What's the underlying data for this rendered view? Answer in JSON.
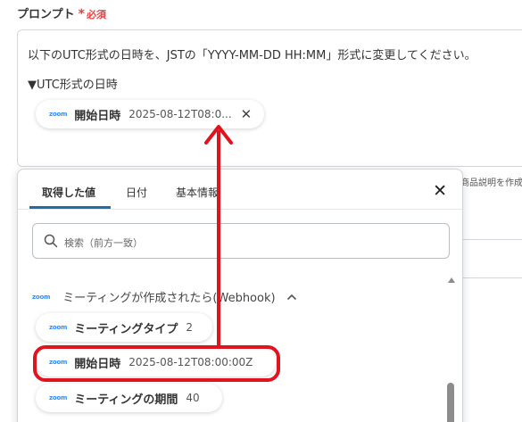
{
  "field": {
    "label": "プロンプト",
    "required_mark": "*",
    "required_text": "必須",
    "line1": "以下のUTC形式の日時を、JSTの「YYYY-MM-DD HH:MM」形式に変更してください。",
    "line2": "▼UTC形式の日時",
    "chip": {
      "logo": "zoom",
      "name": "開始日時",
      "value": "2025-08-12T08:0..."
    }
  },
  "background_hint": "商品説明を作成",
  "panel": {
    "tabs": [
      "取得した値",
      "日付",
      "基本情報"
    ],
    "active_tab": 0,
    "search_placeholder": "検索（前方一致）",
    "group": {
      "logo": "zoom",
      "name": "ミーティングが作成されたら(Webhook)"
    },
    "items": [
      {
        "logo": "zoom",
        "name": "ミーティングタイプ",
        "value": "2"
      },
      {
        "logo": "zoom",
        "name": "開始日時",
        "value": "2025-08-12T08:00:00Z"
      },
      {
        "logo": "zoom",
        "name": "ミーティングの期間",
        "value": "40"
      }
    ]
  },
  "colors": {
    "required": "#e8413f",
    "zoom": "#2d8cff",
    "active_tab": "#1d6ea6",
    "annotation": "#e0141e"
  },
  "icons": [
    "close-icon",
    "search-icon",
    "chevron-up-icon",
    "zoom-logo"
  ]
}
